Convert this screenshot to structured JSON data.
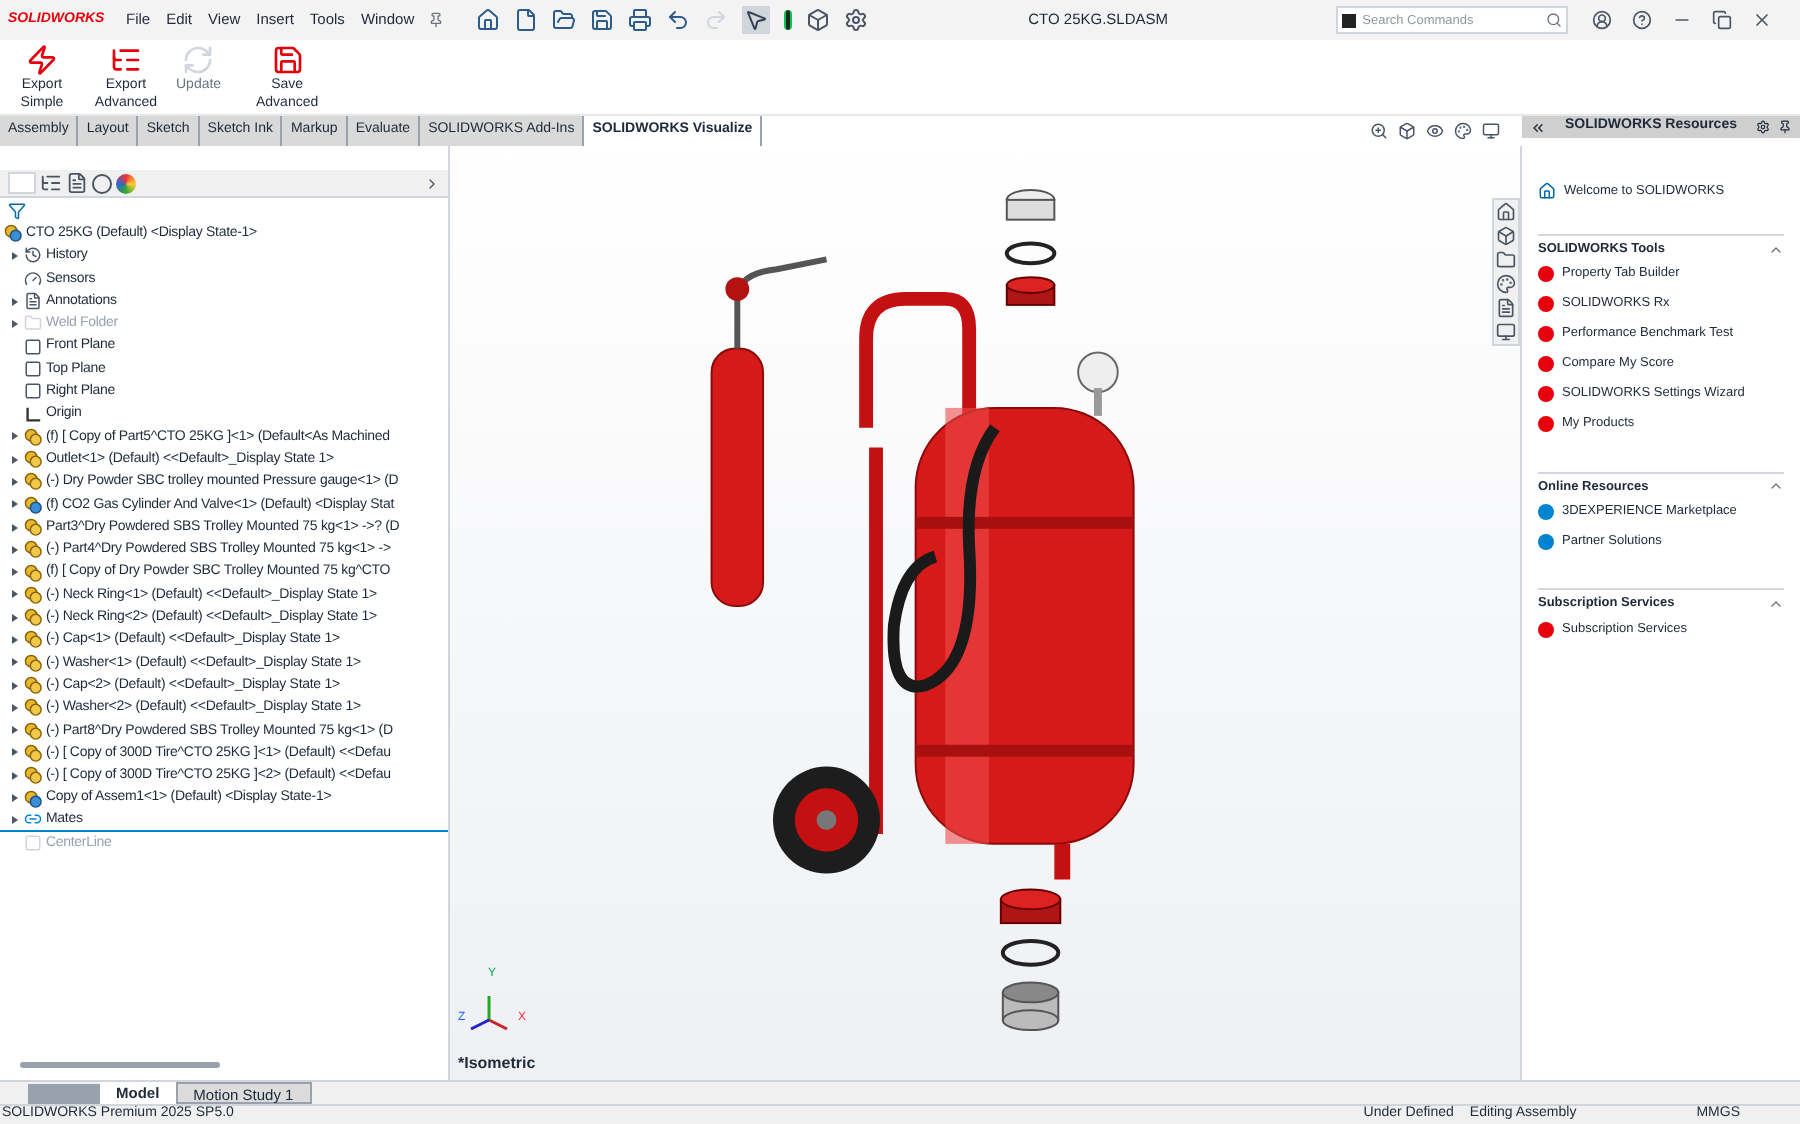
{
  "app": {
    "logo": "SOLIDWORKS",
    "document_title": "CTO 25KG.SLDASM",
    "search": {
      "placeholder": "Search Commands"
    }
  },
  "menu": [
    "File",
    "Edit",
    "View",
    "Insert",
    "Tools",
    "Window"
  ],
  "ribbon": [
    {
      "label": "Export Simple",
      "disabled": false,
      "kind": "bolt"
    },
    {
      "label": "Export Advanced",
      "disabled": false,
      "kind": "list"
    },
    {
      "label": "Update",
      "disabled": true,
      "kind": "refresh"
    },
    {
      "label": "Save Advanced",
      "disabled": false,
      "kind": "save"
    }
  ],
  "command_tabs": [
    {
      "label": "Assembly",
      "selected": false
    },
    {
      "label": "Layout",
      "selected": false
    },
    {
      "label": "Sketch",
      "selected": false
    },
    {
      "label": "Sketch Ink",
      "selected": false
    },
    {
      "label": "Markup",
      "selected": false
    },
    {
      "label": "Evaluate",
      "selected": false
    },
    {
      "label": "SOLIDWORKS Add-Ins",
      "selected": false
    },
    {
      "label": "SOLIDWORKS Visualize",
      "selected": true
    }
  ],
  "tree": {
    "root": "CTO 25KG (Default) <Display State-1>",
    "items": [
      {
        "label": "History",
        "kind": "history",
        "expandable": true,
        "disabled": false
      },
      {
        "label": "Sensors",
        "kind": "sensors",
        "expandable": false,
        "disabled": false
      },
      {
        "label": "Annotations",
        "kind": "annotations",
        "expandable": true,
        "disabled": false
      },
      {
        "label": "Weld Folder",
        "kind": "folder",
        "expandable": true,
        "disabled": true
      },
      {
        "label": "Front Plane",
        "kind": "plane",
        "expandable": false,
        "disabled": false
      },
      {
        "label": "Top Plane",
        "kind": "plane",
        "expandable": false,
        "disabled": false
      },
      {
        "label": "Right Plane",
        "kind": "plane",
        "expandable": false,
        "disabled": false
      },
      {
        "label": "Origin",
        "kind": "origin",
        "expandable": false,
        "disabled": false
      },
      {
        "label": "(f) [ Copy of Part5^CTO 25KG ]<1> (Default<As Machined",
        "kind": "part",
        "expandable": true,
        "disabled": false
      },
      {
        "label": "Outlet<1> (Default) <<Default>_Display State 1>",
        "kind": "part",
        "expandable": true,
        "disabled": false
      },
      {
        "label": "(-) Dry Powder SBC trolley mounted Pressure gauge<1> (D",
        "kind": "part",
        "expandable": true,
        "disabled": false
      },
      {
        "label": "(f) CO2 Gas Cylinder And Valve<1> (Default) <Display Stat",
        "kind": "assembly",
        "expandable": true,
        "disabled": false
      },
      {
        "label": "Part3^Dry Powdered SBS Trolley Mounted 75 kg<1> ->? (D",
        "kind": "part",
        "expandable": true,
        "disabled": false
      },
      {
        "label": "(-) Part4^Dry Powdered SBS Trolley Mounted 75 kg<1> ->",
        "kind": "part",
        "expandable": true,
        "disabled": false
      },
      {
        "label": "(f) [ Copy of Dry Powder SBC Trolley Mounted 75 kg^CTO",
        "kind": "part",
        "expandable": true,
        "disabled": false
      },
      {
        "label": "(-) Neck Ring<1> (Default) <<Default>_Display State 1>",
        "kind": "part",
        "expandable": true,
        "disabled": false
      },
      {
        "label": "(-) Neck Ring<2> (Default) <<Default>_Display State 1>",
        "kind": "part",
        "expandable": true,
        "disabled": false
      },
      {
        "label": "(-) Cap<1> (Default) <<Default>_Display State 1>",
        "kind": "part",
        "expandable": true,
        "disabled": false
      },
      {
        "label": "(-) Washer<1> (Default) <<Default>_Display State 1>",
        "kind": "part",
        "expandable": true,
        "disabled": false
      },
      {
        "label": "(-) Cap<2> (Default) <<Default>_Display State 1>",
        "kind": "part",
        "expandable": true,
        "disabled": false
      },
      {
        "label": "(-) Washer<2> (Default) <<Default>_Display State 1>",
        "kind": "part",
        "expandable": true,
        "disabled": false
      },
      {
        "label": "(-) Part8^Dry Powdered SBS Trolley Mounted 75 kg<1> (D",
        "kind": "part",
        "expandable": true,
        "disabled": false
      },
      {
        "label": "(-) [ Copy of 300D Tire^CTO 25KG ]<1> (Default) <<Defau",
        "kind": "part",
        "expandable": true,
        "disabled": false
      },
      {
        "label": "(-) [ Copy of 300D Tire^CTO 25KG ]<2> (Default) <<Defau",
        "kind": "part",
        "expandable": true,
        "disabled": false
      },
      {
        "label": "Copy of Assem1<1> (Default) <Display State-1>",
        "kind": "assembly",
        "expandable": true,
        "disabled": false
      },
      {
        "label": "Mates",
        "kind": "mates",
        "expandable": true,
        "disabled": false
      },
      {
        "label": "CenterLine",
        "kind": "plane",
        "expandable": false,
        "disabled": true
      }
    ]
  },
  "viewport": {
    "view_label": "*Isometric",
    "triad": [
      "X",
      "Y",
      "Z"
    ]
  },
  "resources": {
    "title": "SOLIDWORKS Resources",
    "welcome": "Welcome to SOLIDWORKS",
    "sections": [
      {
        "title": "SOLIDWORKS Tools",
        "expanded": true,
        "items": [
          "Property Tab Builder",
          "SOLIDWORKS Rx",
          "Performance Benchmark Test",
          "Compare My Score",
          "SOLIDWORKS Settings Wizard",
          "My Products"
        ]
      },
      {
        "title": "Online Resources",
        "expanded": true,
        "items": [
          "3DEXPERIENCE Marketplace",
          "Partner Solutions"
        ]
      },
      {
        "title": "Subscription Services",
        "expanded": true,
        "items": [
          "Subscription Services"
        ]
      }
    ]
  },
  "bottom_tabs": [
    {
      "label": "Model",
      "selected": true
    },
    {
      "label": "Motion Study 1",
      "selected": false
    }
  ],
  "status_bar": {
    "product": "SOLIDWORKS Premium 2025 SP5.0",
    "state": "Under Defined",
    "mode": "Editing Assembly",
    "units": "MMGS"
  }
}
